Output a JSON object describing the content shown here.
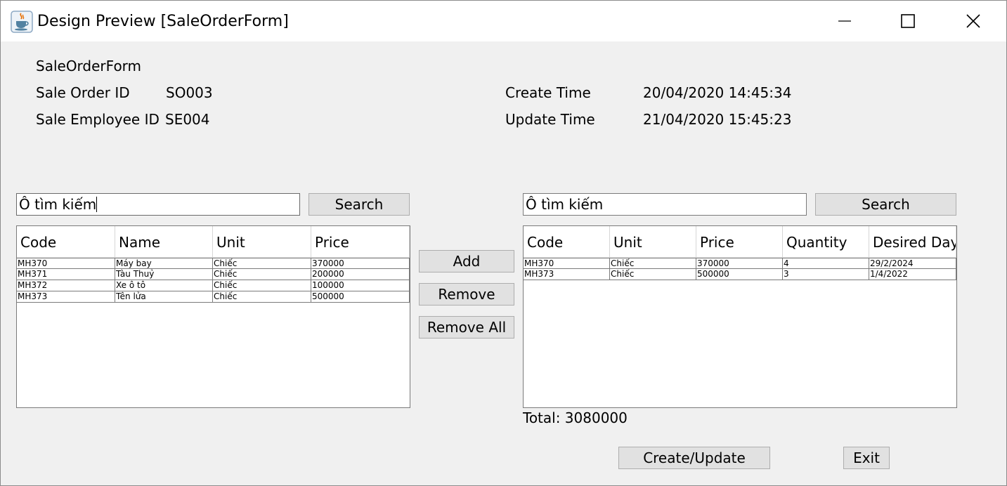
{
  "window": {
    "title": "Design Preview [SaleOrderForm]"
  },
  "form": {
    "heading": "SaleOrderForm",
    "sale_order_id_label": "Sale Order ID",
    "sale_order_id_value": "SO003",
    "sale_employee_id_label": "Sale Employee ID",
    "sale_employee_id_value": "SE004",
    "create_time_label": "Create Time",
    "create_time_value": "20/04/2020 14:45:34",
    "update_time_label": "Update Time",
    "update_time_value": "21/04/2020 15:45:23"
  },
  "left_panel": {
    "search_value": "Ô tìm kiếm",
    "search_button": "Search",
    "columns": [
      "Code",
      "Name",
      "Unit",
      "Price"
    ],
    "rows": [
      [
        "MH370",
        "Máy bay",
        "Chiếc",
        "370000"
      ],
      [
        "MH371",
        "Tàu Thuỷ",
        "Chiếc",
        "200000"
      ],
      [
        "MH372",
        "Xe ô tô",
        "Chiếc",
        "100000"
      ],
      [
        "MH373",
        "Tên lửa",
        "Chiếc",
        "500000"
      ]
    ]
  },
  "middle": {
    "add_button": "Add",
    "remove_button": "Remove",
    "remove_all_button": "Remove All"
  },
  "right_panel": {
    "search_value": "Ô tìm kiếm",
    "search_button": "Search",
    "columns": [
      "Code",
      "Unit",
      "Price",
      "Quantity",
      "Desired Day"
    ],
    "rows": [
      [
        "MH370",
        "Chiếc",
        "370000",
        "4",
        "29/2/2024"
      ],
      [
        "MH373",
        "Chiếc",
        "500000",
        "3",
        "1/4/2022"
      ]
    ],
    "total_text": "Total: 3080000"
  },
  "footer": {
    "create_update_button": "Create/Update",
    "exit_button": "Exit"
  },
  "icons": {
    "app": "java-coffee-cup-icon",
    "minimize": "minimize-icon",
    "maximize": "maximize-icon",
    "close": "close-icon"
  }
}
